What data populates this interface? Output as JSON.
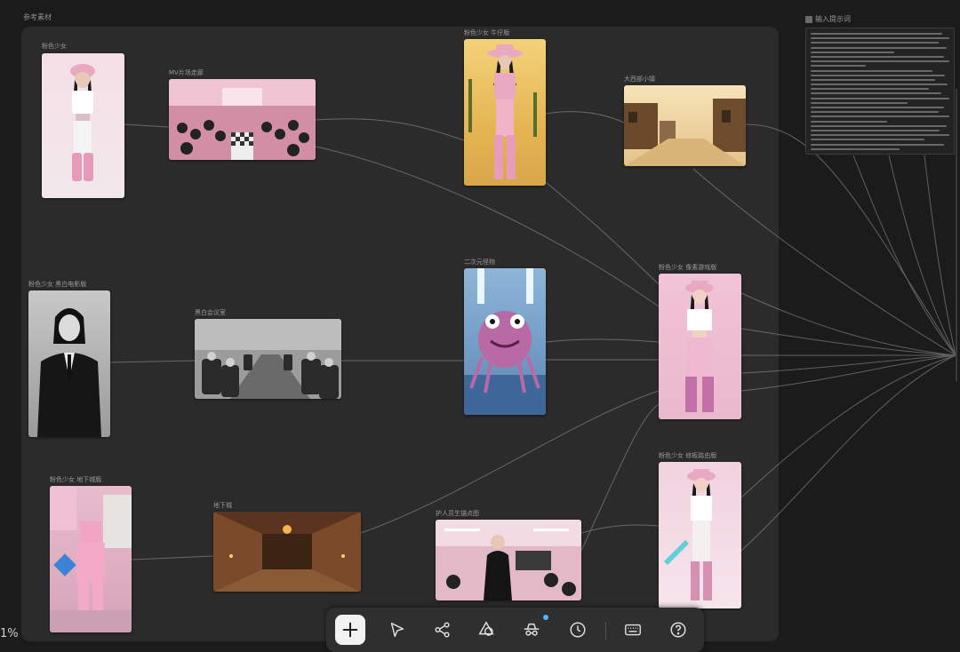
{
  "canvas": {
    "title": "参考素材",
    "zoom_text": "1%"
  },
  "colors": {
    "board": "#2b2b2b",
    "link": "#9a9a9a",
    "accent": "#4fb6ff"
  },
  "nodes": {
    "pink_girl": {
      "label": "粉色少女"
    },
    "mv_scene": {
      "label": "MV片场走廊"
    },
    "pink_cowgirl": {
      "label": "粉色少女 牛仔版"
    },
    "west_town": {
      "label": "大西部小镇"
    },
    "pink_bw": {
      "label": "粉色少女 黑白电影版"
    },
    "bw_meeting": {
      "label": "黑白会议室"
    },
    "monster": {
      "label": "二次元怪物"
    },
    "pink_pixel": {
      "label": "粉色少女 像素游戏版"
    },
    "pink_underground": {
      "label": "粉色少女 地下城版"
    },
    "dungeon": {
      "label": "地下城"
    },
    "anchor_scene": {
      "label": "护人员生锚点图"
    },
    "pink_minecraft": {
      "label": "粉色少女 修板路由版"
    }
  },
  "prompt": {
    "title": "输入提示词"
  },
  "toolbar": {
    "tools": [
      {
        "name": "add",
        "icon": "plus-icon"
      },
      {
        "name": "select",
        "icon": "pointer-icon"
      },
      {
        "name": "workflow",
        "icon": "workflow-icon"
      },
      {
        "name": "shapes",
        "icon": "shapes-icon"
      },
      {
        "name": "agent",
        "icon": "incognito-icon"
      },
      {
        "name": "history",
        "icon": "clock-icon"
      },
      {
        "name": "keyboard",
        "icon": "keyboard-icon"
      },
      {
        "name": "help",
        "icon": "help-icon"
      }
    ]
  }
}
